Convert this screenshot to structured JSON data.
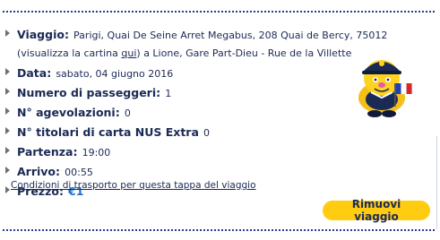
{
  "trip": {
    "departure_label": "Viaggio:",
    "route_prefix": "Parigi, Quai De Seine Arret Megabus, 208 Quai de Bercy, 75012 (visualizza la cartina ",
    "map_link": "qui",
    "route_suffix": ") a Lione, Gare Part-Dieu - Rue de la Villette",
    "date_label": "Data:",
    "date_value": "sabato, 04 giugno 2016",
    "passengers_label": "Numero di passeggeri:",
    "passengers_value": "1",
    "discounts_label": "N° agevolazioni:",
    "discounts_value": "0",
    "nus_label": "N° titolari di carta NUS Extra",
    "nus_value": "0",
    "departure_time_label": "Partenza:",
    "departure_time_value": "19:00",
    "arrival_label": "Arrivo:",
    "arrival_value": "00:55",
    "price_label": "Prezzo:",
    "price_value": "€1"
  },
  "conditions_link": "Condizioni di trasporto per questa tappa del viaggio",
  "remove_button": "Rimuovi viaggio",
  "mascot": {
    "icon": "megabus-mascot-icon",
    "flag": "french-flag"
  },
  "colors": {
    "accent": "#ffcc11",
    "text": "#1b2a55",
    "price": "#1e6fc9",
    "dots": "#2e3a8c"
  }
}
